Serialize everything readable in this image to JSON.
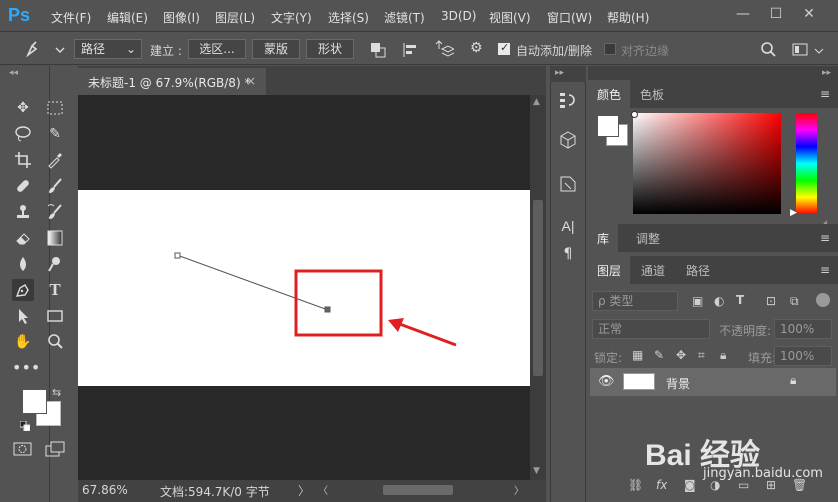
{
  "app": {
    "logo": "Ps"
  },
  "menu": [
    "文件(F)",
    "编辑(E)",
    "图像(I)",
    "图层(L)",
    "文字(Y)",
    "选择(S)",
    "滤镜(T)",
    "3D(D)",
    "视图(V)",
    "窗口(W)",
    "帮助(H)"
  ],
  "window_controls": {
    "minimize": "—",
    "maximize": "☐",
    "close": "✕"
  },
  "options": {
    "mode_value": "路径",
    "make_label": "建立 :",
    "selection_button": "选区...",
    "mask_button": "蒙版",
    "shape_button": "形状",
    "auto_add_delete": "自动添加/删除",
    "auto_add_delete_checked": true,
    "align_edges": "对齐边缘",
    "align_edges_checked": false
  },
  "document": {
    "tab_title": "未标题-1 @ 67.9%(RGB/8) *",
    "tab_close": "×",
    "zoom": "67.86%",
    "doc_info": "文档:594.7K/0 字节"
  },
  "panels": {
    "color_tabs": [
      "颜色",
      "色板"
    ],
    "library_tabs": [
      "库",
      "调整"
    ],
    "layer_tabs": [
      "图层",
      "通道",
      "路径"
    ],
    "layers": {
      "filter_label": "ρ 类型",
      "blend_mode": "正常",
      "opacity_label": "不透明度:",
      "opacity_value": "100%",
      "lock_label": "锁定:",
      "fill_label": "填充:",
      "fill_value": "100%",
      "items": [
        {
          "name": "背景",
          "visible": true,
          "locked": true
        }
      ]
    }
  },
  "watermark": {
    "name": "Bai 经验",
    "url": "jingyan.baidu.com"
  },
  "colors": {
    "accent": "#31a8ff",
    "highlight": "#e02020",
    "panel": "#535353",
    "canvas_bg": "#282828"
  }
}
